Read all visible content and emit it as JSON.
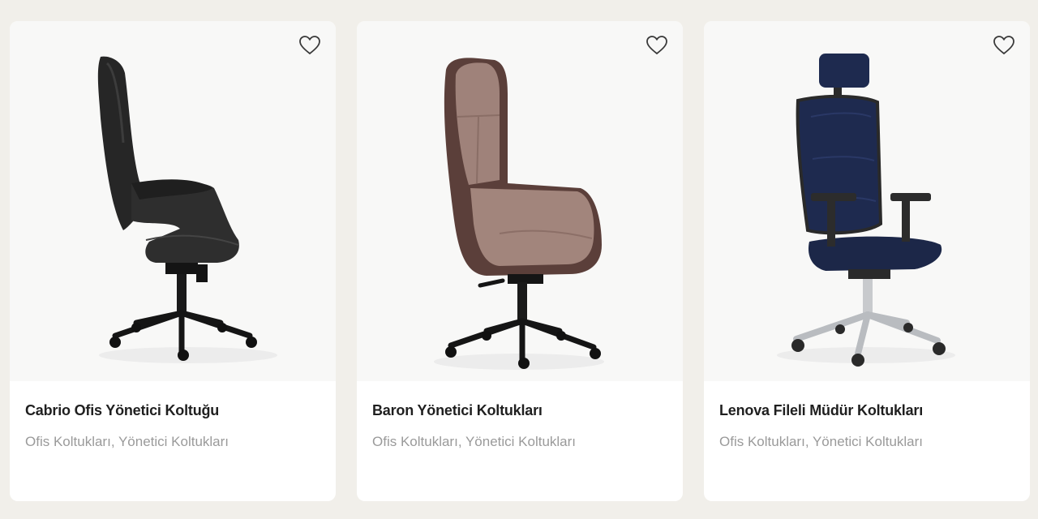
{
  "products": [
    {
      "title": "Cabrio Ofis Yönetici Koltuğu",
      "categories": [
        "Ofis Koltukları",
        "Yönetici Koltukları"
      ],
      "image_alt": "black leather high-back executive chair",
      "colors": {
        "seat": "#2b2b2b",
        "base": "#151515"
      }
    },
    {
      "title": "Baron Yönetici Koltukları",
      "categories": [
        "Ofis Koltukları",
        "Yönetici Koltukları"
      ],
      "image_alt": "brown fabric high-back executive chair",
      "colors": {
        "seat": "#9d8078",
        "shell": "#5a3f3a",
        "base": "#151515"
      }
    },
    {
      "title": "Lenova Fileli Müdür Koltukları",
      "categories": [
        "Ofis Koltukları",
        "Yönetici Koltukları"
      ],
      "image_alt": "navy mesh manager chair with headrest",
      "colors": {
        "mesh": "#1e2a4f",
        "frame": "#2a2a2a",
        "base": "#b9bcc0"
      }
    }
  ],
  "separator": ", ",
  "favorite_icon": "heart-outline-icon"
}
